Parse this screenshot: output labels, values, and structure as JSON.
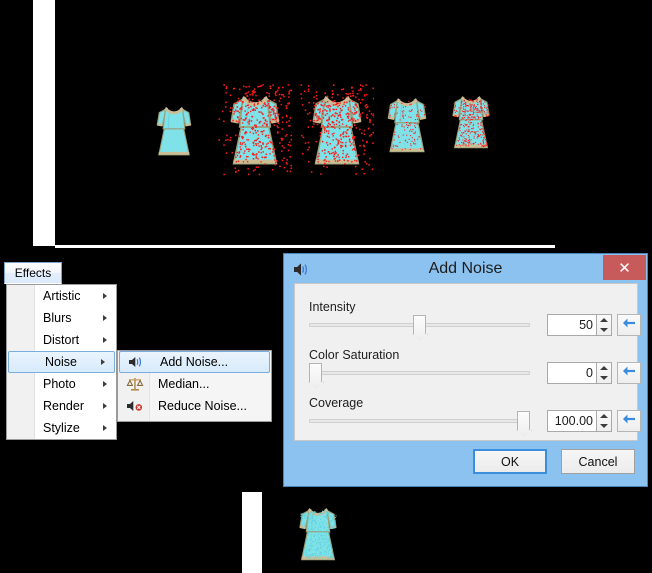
{
  "app": {
    "canvas_background": "#000000",
    "image_strip_color": "#ffffff"
  },
  "menubar": {
    "effects_label": "Effects"
  },
  "effects_menu": {
    "items": [
      {
        "label": "Artistic",
        "has_submenu": true,
        "selected": false,
        "icon": ""
      },
      {
        "label": "Blurs",
        "has_submenu": true,
        "selected": false,
        "icon": ""
      },
      {
        "label": "Distort",
        "has_submenu": true,
        "selected": false,
        "icon": ""
      },
      {
        "label": "Noise",
        "has_submenu": true,
        "selected": true,
        "icon": ""
      },
      {
        "label": "Photo",
        "has_submenu": true,
        "selected": false,
        "icon": ""
      },
      {
        "label": "Render",
        "has_submenu": true,
        "selected": false,
        "icon": ""
      },
      {
        "label": "Stylize",
        "has_submenu": true,
        "selected": false,
        "icon": ""
      }
    ]
  },
  "noise_submenu": {
    "items": [
      {
        "label": "Add Noise...",
        "icon": "speaker-add-noise-icon",
        "selected": true
      },
      {
        "label": "Median...",
        "icon": "scales-median-icon",
        "selected": false
      },
      {
        "label": "Reduce Noise...",
        "icon": "speaker-reduce-noise-icon",
        "selected": false
      }
    ]
  },
  "dialog": {
    "title": "Add Noise",
    "title_icon": "speaker-noise-icon",
    "close_label": "✕",
    "accent_color": "#8cc2f0",
    "close_color": "#c75b5c",
    "controls": [
      {
        "label": "Intensity",
        "value": "50",
        "slider_percent": 50,
        "reset_icon": "reset-arrow-icon"
      },
      {
        "label": "Color Saturation",
        "value": "0",
        "slider_percent": 0,
        "reset_icon": "reset-arrow-icon"
      },
      {
        "label": "Coverage",
        "value": "100.00",
        "slider_percent": 100,
        "reset_icon": "reset-arrow-icon"
      }
    ],
    "ok_label": "OK",
    "cancel_label": "Cancel"
  },
  "sprites": {
    "body_color": "#7fe2e8",
    "body_shade": "#6ed4dc",
    "trim_color": "#cbbd94",
    "outline_color": "#9aa07a",
    "noise_color": "#ff1b1b",
    "preview_strip": [
      {
        "name": "dress-original",
        "noise_density": 0,
        "scatter": 0
      },
      {
        "name": "dress-noise-scattered-a",
        "noise_density": 0.3,
        "scatter": 1
      },
      {
        "name": "dress-noise-scattered-b",
        "noise_density": 0.3,
        "scatter": 1
      },
      {
        "name": "dress-noise-inner",
        "noise_density": 0.18,
        "scatter": 0
      },
      {
        "name": "dress-noise-dense",
        "noise_density": 0.55,
        "scatter": 0
      }
    ],
    "bottom_preview": {
      "name": "dress-result-preview",
      "noise_density": 0.55,
      "scatter": 0
    }
  }
}
